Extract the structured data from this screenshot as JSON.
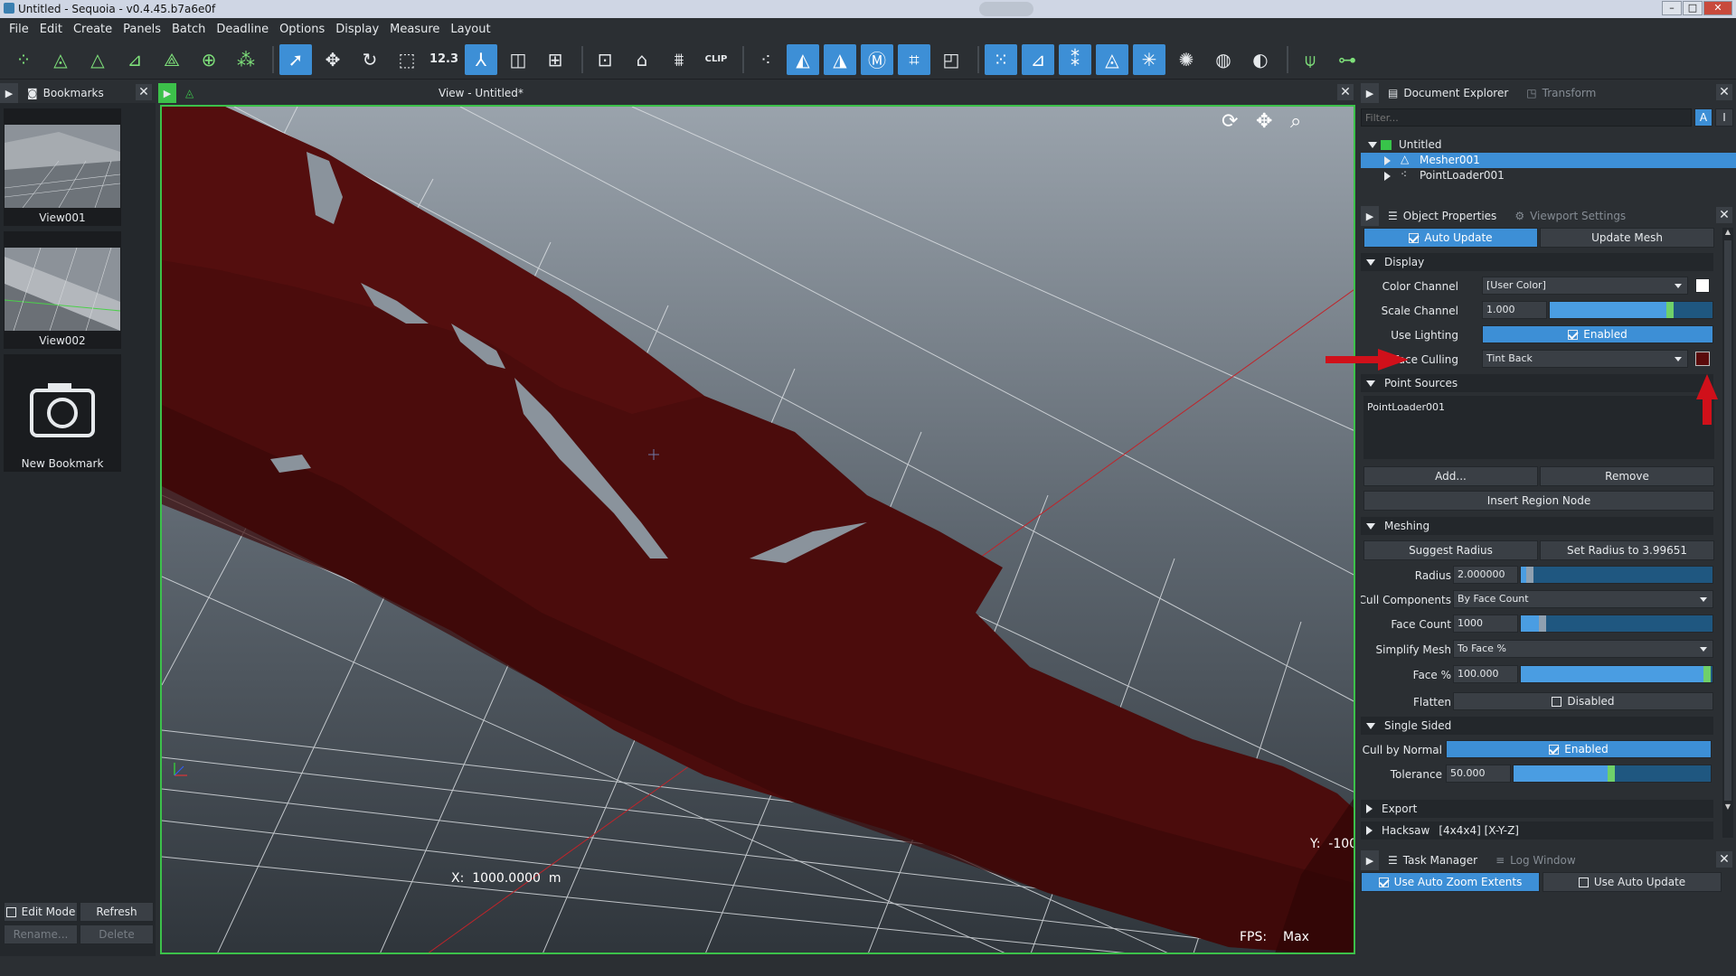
{
  "window": {
    "title": "Untitled - Sequoia - v0.4.45.b7a6e0f",
    "min": "–",
    "max": "□",
    "close": "✕"
  },
  "menu": [
    "File",
    "Edit",
    "Create",
    "Panels",
    "Batch",
    "Deadline",
    "Options",
    "Display",
    "Measure",
    "Layout"
  ],
  "toolbar": {
    "measure_label": "12.3",
    "clip_label": "CLIP"
  },
  "bookmarks": {
    "tab": "Bookmarks",
    "items": [
      {
        "label": "View001"
      },
      {
        "label": "View002"
      },
      {
        "label": "New Bookmark"
      }
    ],
    "edit_mode": "Edit Mode",
    "refresh": "Refresh",
    "rename": "Rename...",
    "delete": "Delete"
  },
  "viewport": {
    "title": "View - Untitled*",
    "x_readout": "X:  1000.0000  m",
    "y_readout": "Y:  -100",
    "fps_label": "FPS:",
    "fps_value": "Max"
  },
  "doc_explorer": {
    "tab": "Document Explorer",
    "tab2": "Transform",
    "filter_placeholder": "Filter...",
    "tree": [
      "Untitled",
      "Mesher001",
      "PointLoader001"
    ],
    "btn_a": "A",
    "btn_b": "I"
  },
  "properties": {
    "tab": "Object Properties",
    "tab2": "Viewport Settings",
    "auto_update": "Auto Update",
    "update_mesh": "Update Mesh",
    "display_section": "Display",
    "color_channel_label": "Color Channel",
    "color_channel_value": "[User Color]",
    "scale_channel_label": "Scale Channel",
    "scale_channel_value": "1.000",
    "scale_channel_level": 0.76,
    "use_lighting_label": "Use Lighting",
    "use_lighting_value": "Enabled",
    "face_culling_label": "Face Culling",
    "face_culling_value": "Tint Back",
    "face_culling_color": "#5a0b0b",
    "point_sources_section": "Point Sources",
    "point_sources_item": "PointLoader001",
    "add": "Add...",
    "remove": "Remove",
    "insert_region": "Insert Region Node",
    "meshing_section": "Meshing",
    "suggest_radius": "Suggest Radius",
    "set_radius": "Set Radius to 3.99651",
    "radius_label": "Radius",
    "radius_value": "2.000000",
    "radius_level": 0.03,
    "cull_components_label": "Cull Components",
    "cull_components_value": "By Face Count",
    "face_count_label": "Face Count",
    "face_count_value": "1000",
    "face_count_level": 0.1,
    "simplify_mesh_label": "Simplify Mesh",
    "simplify_mesh_value": "To Face %",
    "face_pct_label": "Face %",
    "face_pct_value": "100.000",
    "face_pct_level": 1.0,
    "flatten_label": "Flatten",
    "flatten_value": "Disabled",
    "single_sided_section": "Single Sided",
    "cull_by_normal_label": "Cull by Normal",
    "cull_by_normal_value": "Enabled",
    "tolerance_label": "Tolerance",
    "tolerance_value": "50.000",
    "tolerance_level": 0.5,
    "export_section": "Export",
    "hacksaw_section": "Hacksaw",
    "hacksaw_value": "[4x4x4] [X-Y-Z]"
  },
  "tasks": {
    "tab": "Task Manager",
    "tab2": "Log Window",
    "auto_zoom": "Use Auto Zoom Extents",
    "auto_update": "Use Auto Update"
  },
  "colors": {
    "accent": "#3d8fd6",
    "viewport_border": "#3cc14a",
    "mesh": "#4a0c0c",
    "arrow": "#d0101a"
  }
}
